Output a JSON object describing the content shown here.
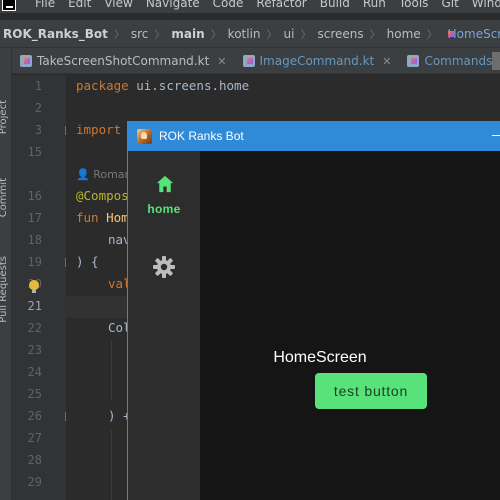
{
  "menu": {
    "items": [
      "File",
      "Edit",
      "View",
      "Navigate",
      "Code",
      "Refactor",
      "Build",
      "Run",
      "Tools",
      "Git",
      "Window"
    ]
  },
  "breadcrumb": {
    "items": [
      "ROK_Ranks_Bot",
      "src",
      "main",
      "kotlin",
      "ui",
      "screens",
      "home",
      "HomeScreen.kt",
      "Ho"
    ]
  },
  "toolstrip": {
    "project_label": "Project",
    "commit_label": "Commit",
    "pull_requests_label": "Pull Requests"
  },
  "tabs": [
    {
      "label": "TakeScreenShotCommand.kt"
    },
    {
      "label": "ImageCommand.kt"
    },
    {
      "label": "Commands.kt"
    }
  ],
  "gutter": {
    "line_numbers": [
      "1",
      "2",
      "3",
      "15",
      "16",
      "17",
      "18",
      "19",
      "20",
      "21",
      "22",
      "23",
      "24",
      "25",
      "26",
      "27",
      "28",
      "29"
    ]
  },
  "code": {
    "line1_kw": "package",
    "line1_txt": " ui.screens.home",
    "line3_kw": "import",
    "hint_author": "Roman",
    "line16": "@Compos",
    "line17_kw": "fun",
    "line17_fn": " Hom",
    "line18": "nav",
    "line19": ") {",
    "line20_kw": "val",
    "line22": "Col",
    "line26": ") +"
  },
  "app": {
    "window_title": "ROK Ranks Bot",
    "nav": {
      "home_label": "home",
      "home_icon": "home-icon",
      "settings_icon": "gear-icon"
    },
    "screen_text": "HomeScreen",
    "button_label": "test button",
    "accent_color": "#58e27a",
    "titlebar_color": "#2f8ad8"
  }
}
